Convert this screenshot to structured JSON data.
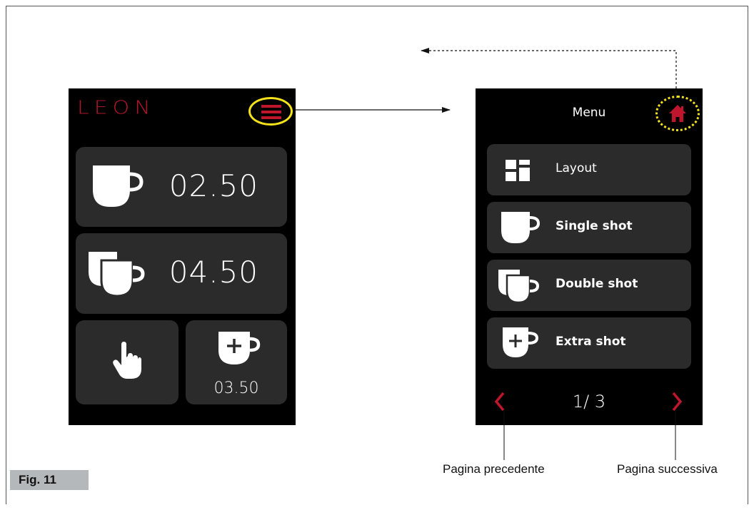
{
  "left_screen": {
    "logo": "LEON",
    "tiles": [
      {
        "icon": "single-cup-icon",
        "price": "02.50"
      },
      {
        "icon": "double-cup-icon",
        "price": "04.50"
      },
      {
        "icon": "hand-pointer-icon"
      },
      {
        "icon": "extra-cup-icon",
        "price": "03.50"
      }
    ]
  },
  "right_screen": {
    "title": "Menu",
    "items": [
      {
        "label": "Layout",
        "icon": "layout-grid-icon"
      },
      {
        "label": "Single shot",
        "icon": "single-cup-icon"
      },
      {
        "label": "Double shot",
        "icon": "double-cup-icon"
      },
      {
        "label": "Extra shot",
        "icon": "extra-cup-icon"
      }
    ],
    "pager": "1/ 3"
  },
  "annotations": {
    "prev_page": "Pagina precedente",
    "next_page": "Pagina successiva",
    "figure": "Fig. 11"
  },
  "colors": {
    "accent_red": "#c0162d",
    "highlight_yellow": "#f4e21b",
    "tile_bg": "#2b2b2b",
    "screen_bg": "#000000"
  }
}
